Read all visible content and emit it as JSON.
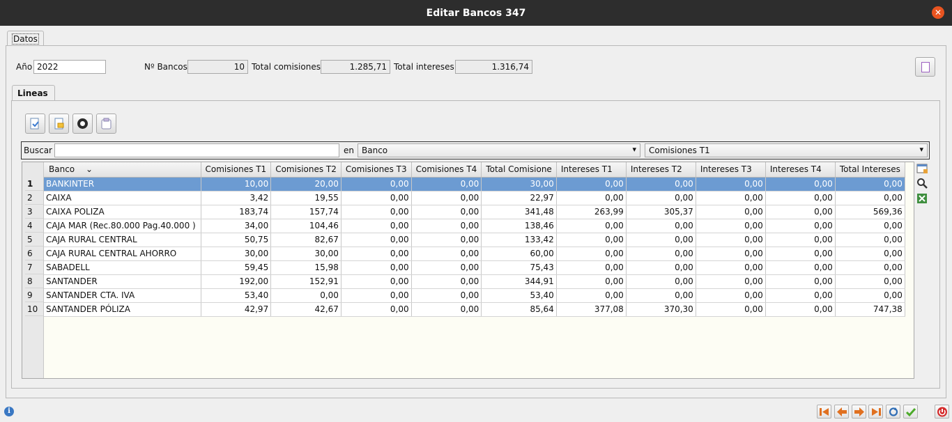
{
  "window": {
    "title": "Editar Bancos 347"
  },
  "tabs": {
    "outer": "Datos",
    "inner": "Lineas"
  },
  "header": {
    "year_label": "Año",
    "year_value": "2022",
    "num_banks_label": "Nº Bancos",
    "num_banks_value": "10",
    "total_comisiones_label": "Total comisiones",
    "total_comisiones_value": "1.285,71",
    "total_intereses_label": "Total intereses",
    "total_intereses_value": "1.316,74"
  },
  "search": {
    "label": "Buscar",
    "value": "",
    "in_label": "en",
    "field_select": "Banco",
    "sort_select": "Comisiones T1"
  },
  "table": {
    "columns": [
      "Banco",
      "Comisiones T1",
      "Comisiones T2",
      "Comisiones T3",
      "Comisiones T4",
      "Total Comisione",
      "Intereses T1",
      "Intereses T2",
      "Intereses T3",
      "Intereses T4",
      "Total Intereses"
    ],
    "sort_indicator": "⌄",
    "rows": [
      {
        "n": "1",
        "cells": [
          "BANKINTER",
          "10,00",
          "20,00",
          "0,00",
          "0,00",
          "30,00",
          "0,00",
          "0,00",
          "0,00",
          "0,00",
          "0,00"
        ]
      },
      {
        "n": "2",
        "cells": [
          "CAIXA",
          "3,42",
          "19,55",
          "0,00",
          "0,00",
          "22,97",
          "0,00",
          "0,00",
          "0,00",
          "0,00",
          "0,00"
        ]
      },
      {
        "n": "3",
        "cells": [
          "CAIXA POLIZA",
          "183,74",
          "157,74",
          "0,00",
          "0,00",
          "341,48",
          "263,99",
          "305,37",
          "0,00",
          "0,00",
          "569,36"
        ]
      },
      {
        "n": "4",
        "cells": [
          "CAJA MAR (Rec.80.000 Pag.40.000 )",
          "34,00",
          "104,46",
          "0,00",
          "0,00",
          "138,46",
          "0,00",
          "0,00",
          "0,00",
          "0,00",
          "0,00"
        ]
      },
      {
        "n": "5",
        "cells": [
          "CAJA RURAL CENTRAL",
          "50,75",
          "82,67",
          "0,00",
          "0,00",
          "133,42",
          "0,00",
          "0,00",
          "0,00",
          "0,00",
          "0,00"
        ]
      },
      {
        "n": "6",
        "cells": [
          "CAJA RURAL CENTRAL AHORRO",
          "30,00",
          "30,00",
          "0,00",
          "0,00",
          "60,00",
          "0,00",
          "0,00",
          "0,00",
          "0,00",
          "0,00"
        ]
      },
      {
        "n": "7",
        "cells": [
          "SABADELL",
          "59,45",
          "15,98",
          "0,00",
          "0,00",
          "75,43",
          "0,00",
          "0,00",
          "0,00",
          "0,00",
          "0,00"
        ]
      },
      {
        "n": "8",
        "cells": [
          "SANTANDER",
          "192,00",
          "152,91",
          "0,00",
          "0,00",
          "344,91",
          "0,00",
          "0,00",
          "0,00",
          "0,00",
          "0,00"
        ]
      },
      {
        "n": "9",
        "cells": [
          "SANTANDER CTA. IVA",
          "53,40",
          "0,00",
          "0,00",
          "0,00",
          "53,40",
          "0,00",
          "0,00",
          "0,00",
          "0,00",
          "0,00"
        ]
      },
      {
        "n": "10",
        "cells": [
          "SANTANDER PÓLIZA",
          "42,97",
          "42,67",
          "0,00",
          "0,00",
          "85,64",
          "377,08",
          "370,30",
          "0,00",
          "0,00",
          "747,38"
        ]
      }
    ]
  },
  "colors": {
    "titlebar": "#2d2d2d",
    "close": "#e95420",
    "selection": "#6c9bd2"
  },
  "icons": {
    "close": "close-icon",
    "print": "document-icon",
    "toolbar": [
      "new-line-icon",
      "edit-line-icon",
      "delete-line-icon",
      "clipboard-icon"
    ],
    "side": [
      "table-config-icon",
      "magnifier-icon",
      "excel-icon"
    ],
    "nav": [
      "first-icon",
      "prev-icon",
      "next-icon",
      "last-icon",
      "refresh-icon",
      "accept-icon",
      "exit-icon"
    ],
    "info": "info-icon"
  }
}
